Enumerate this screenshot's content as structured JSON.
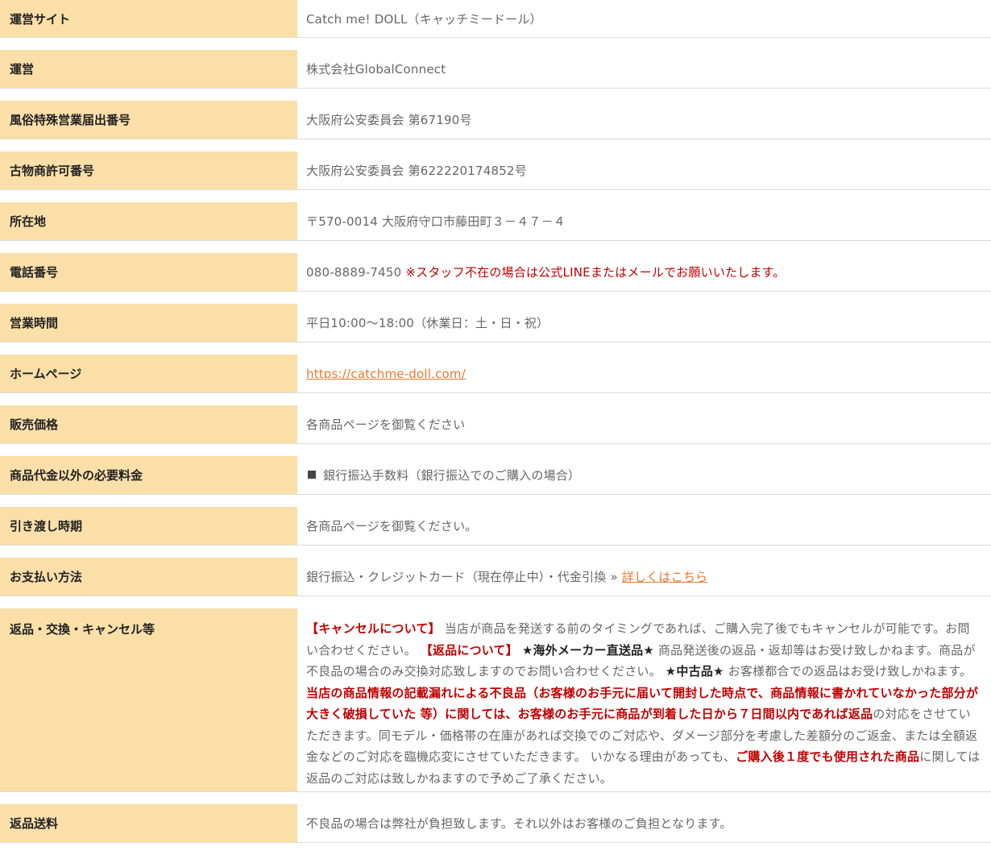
{
  "rows": [
    {
      "label": "運営サイト",
      "value": "Catch me! DOLL（キャッチミードール）"
    },
    {
      "label": "運営",
      "value": "株式会社GlobalConnect"
    },
    {
      "label": "風俗特殊営業届出番号",
      "value": "大阪府公安委員会 第67190号"
    },
    {
      "label": "古物商許可番号",
      "value": "大阪府公安委員会 第622220174852号"
    },
    {
      "label": "所在地",
      "value": "〒570-0014 大阪府守口市藤田町３－４７－４"
    },
    {
      "label": "電話番号",
      "value": "080-8889-7450",
      "note": "※スタッフ不在の場合は公式LINEまたはメールでお願いいたします。"
    },
    {
      "label": "営業時間",
      "value": "平日10:00～18:00（休業日：土・日・祝）"
    },
    {
      "label": "ホームページ",
      "link": "https://catchme-doll.com/"
    },
    {
      "label": "販売価格",
      "value": "各商品ページを御覧ください"
    },
    {
      "label": "商品代金以外の必要料金",
      "value": "銀行振込手数料（銀行振込でのご購入の場合）"
    },
    {
      "label": "引き渡し時期",
      "value": "各商品ページを御覧ください。"
    },
    {
      "label": "お支払い方法",
      "value": "銀行振込・クレジットカード（現在停止中）・代金引換 » ",
      "link": "詳しくはこちら"
    },
    {
      "label": "返品・交換・キャンセル等",
      "parts": [
        "【キャンセルについて】",
        " 当店が商品を発送する前のタイミングであれば、ご購入完了後でもキャンセルが可能です。お問い合わせください。 ",
        "【返品について】",
        " ",
        "★海外メーカー直送品★",
        " 商品発送後の返品・返却等はお受け致しかねます。商品が不良品の場合のみ交換対応致しますのでお問い合わせください。 ",
        "★中古品★",
        " お客様都合での返品はお受け致しかねます。",
        "当店の商品情報の記載漏れによる不良品（お客様のお手元に届いて開封した時点で、商品情報に書かれていなかった部分が大きく破損していた 等）に関しては、お客様のお手元に商品が到着した日から７日間以内であれば返品",
        "の対応をさせていただきます。同モデル・価格帯の在庫があれば交換でのご対応や、ダメージ部分を考慮した差額分のご返金、または全額返金などのご対応を臨機応変にさせていただきます。 いかなる理由があっても、",
        "ご購入後１度でも使用された商品",
        "に関しては返品のご対応は致しかねますので予めご了承ください。"
      ]
    },
    {
      "label": "返品送料",
      "value": "不良品の場合は弊社が負担致します。それ以外はお客様のご負担となります。"
    }
  ],
  "colors": {
    "header_bg": "#fadfa9",
    "accent": "#e8782c",
    "alert": "#c00000",
    "text": "#666666"
  }
}
